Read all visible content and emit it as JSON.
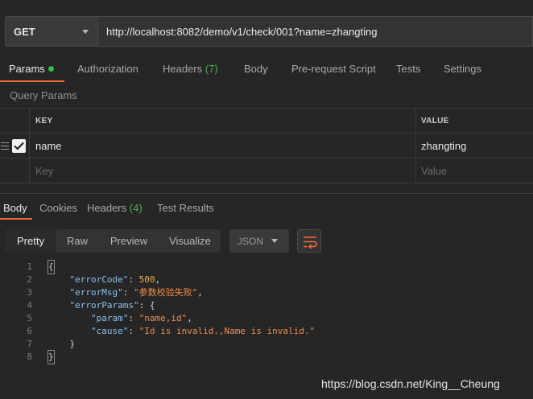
{
  "request": {
    "method": "GET",
    "url": "http://localhost:8082/demo/v1/check/001?name=zhangting"
  },
  "request_tabs": [
    {
      "label": "Params",
      "count": ""
    },
    {
      "label": "Authorization",
      "count": ""
    },
    {
      "label": "Headers",
      "count": "(7)"
    },
    {
      "label": "Body",
      "count": ""
    },
    {
      "label": "Pre-request Script",
      "count": ""
    },
    {
      "label": "Tests",
      "count": ""
    },
    {
      "label": "Settings",
      "count": ""
    }
  ],
  "params": {
    "title": "Query Params",
    "headers": {
      "key": "KEY",
      "value": "VALUE"
    },
    "rows": [
      {
        "key": "name",
        "value": "zhangting",
        "checked": true
      }
    ],
    "placeholder": {
      "key": "Key",
      "value": "Value"
    }
  },
  "response_tabs": [
    {
      "label": "Body",
      "count": ""
    },
    {
      "label": "Cookies",
      "count": ""
    },
    {
      "label": "Headers",
      "count": "(4)"
    },
    {
      "label": "Test Results",
      "count": ""
    }
  ],
  "view_modes": [
    "Pretty",
    "Raw",
    "Preview",
    "Visualize"
  ],
  "format": "JSON",
  "code_lines": [
    "{",
    "    \"errorCode\": 500,",
    "    \"errorMsg\": \"参数校验失败\",",
    "    \"errorParams\": {",
    "        \"param\": \"name,id\",",
    "        \"cause\": \"Id is invalid.,Name is invalid.\"",
    "    }",
    "}"
  ],
  "line_numbers": [
    "1",
    "2",
    "3",
    "4",
    "5",
    "6",
    "7",
    "8"
  ],
  "watermark": "https://blog.csdn.net/King__Cheung",
  "colors": {
    "accent": "#f26b3a",
    "dot_green": "#2bc24a",
    "count_green": "#4fae4f"
  }
}
